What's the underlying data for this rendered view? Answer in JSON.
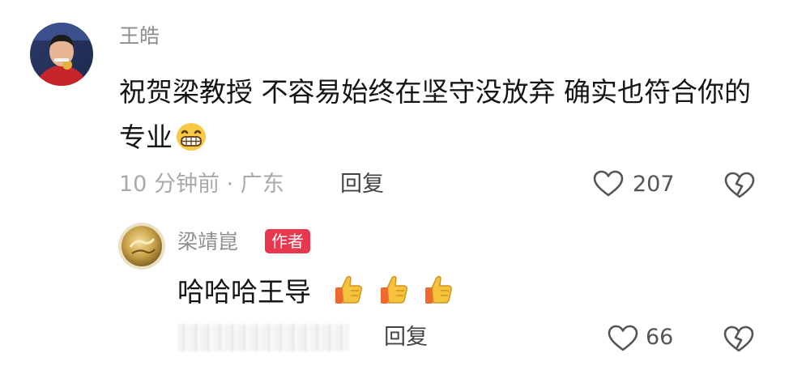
{
  "comment": {
    "username": "王皓",
    "text": "祝贺梁教授 不容易始终在坚守没放弃 确实也符合你的专业",
    "emoji": "grinning-face",
    "time": "10 分钟前",
    "separator": "·",
    "location": "广东",
    "reply_label": "回复",
    "likes": "207"
  },
  "reply": {
    "username": "梁靖崑",
    "badge": "作者",
    "text": "哈哈哈王导",
    "emojis": [
      "thumbs-up",
      "thumbs-up",
      "thumbs-up"
    ],
    "reply_label": "回复",
    "likes": "66"
  },
  "colors": {
    "username": "#8e8e8e",
    "text": "#151515",
    "meta": "#a9a9a9",
    "badge": "#e8384f"
  }
}
